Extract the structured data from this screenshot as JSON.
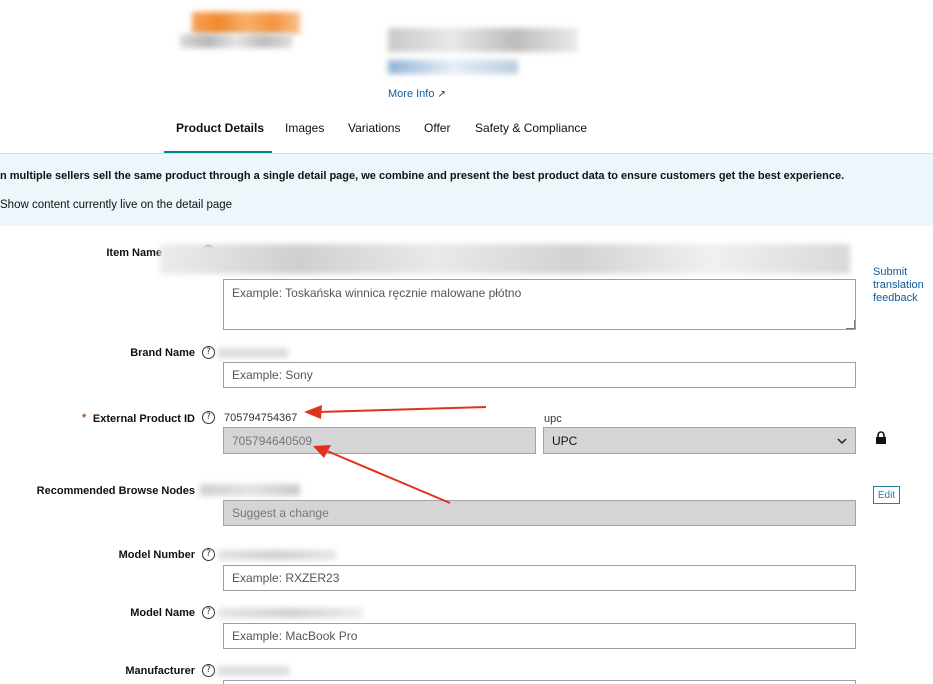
{
  "header": {
    "more_info": "More Info"
  },
  "tabs": [
    {
      "label": "Product Details",
      "active": true
    },
    {
      "label": "Images",
      "active": false
    },
    {
      "label": "Variations",
      "active": false
    },
    {
      "label": "Offer",
      "active": false
    },
    {
      "label": "Safety & Compliance",
      "active": false
    }
  ],
  "banner": {
    "message": "n multiple sellers sell the same product through a single detail page, we combine and present the best product data to ensure customers get the best experience.",
    "toggle_label": "Show content currently live on the detail page"
  },
  "form": {
    "item_name": {
      "label": "Item Name",
      "placeholder": "Example: Toskańska winnica ręcznie malowane płótno",
      "side_link": "Submit translation feedback"
    },
    "brand_name": {
      "label": "Brand Name",
      "placeholder": "Example: Sony"
    },
    "external_product_id": {
      "label": "External Product ID",
      "current_value": "705794754367",
      "type_hint": "upc",
      "value": "705794640509",
      "type_value": "UPC",
      "required_mark": "*"
    },
    "browse_nodes": {
      "label": "Recommended Browse Nodes",
      "placeholder": "Suggest a change",
      "edit_label": "Edit"
    },
    "model_number": {
      "label": "Model Number",
      "placeholder": "Example: RXZER23"
    },
    "model_name": {
      "label": "Model Name",
      "placeholder": "Example: MacBook Pro"
    },
    "manufacturer": {
      "label": "Manufacturer"
    }
  },
  "colors": {
    "tab_underline": "#008296",
    "banner_bg": "#edf6fb",
    "annotation_arrow": "#e0321e",
    "link": "#0f5b9a"
  },
  "icons": {
    "help": "question-circle-icon",
    "lock": "lock-icon",
    "chevron": "chevron-down-icon",
    "external_link": "arrow-up-right-icon"
  }
}
